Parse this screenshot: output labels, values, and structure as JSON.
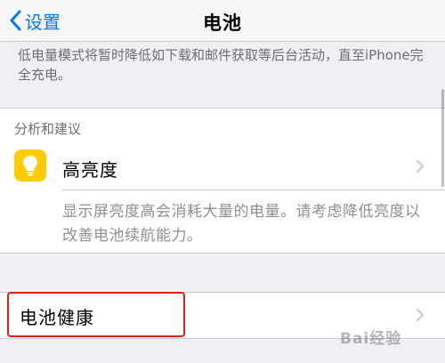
{
  "nav": {
    "back_label": "设置",
    "title": "电池"
  },
  "low_power_footer": "低电量模式将暂时降低如下载和邮件获取等后台活动，直至iPhone完全充电。",
  "insights": {
    "header": "分析和建议",
    "item_label": "高亮度",
    "item_description": "显示屏亮度高会消耗大量的电量。请考虑降低亮度以改善电池续航能力。",
    "icon": "lightbulb-icon"
  },
  "battery_health": {
    "label": "电池健康"
  },
  "watermark": "Bai经验",
  "colors": {
    "accent": "#007aff",
    "icon_bg": "#ffcc00",
    "highlight_border": "#e0201b"
  }
}
